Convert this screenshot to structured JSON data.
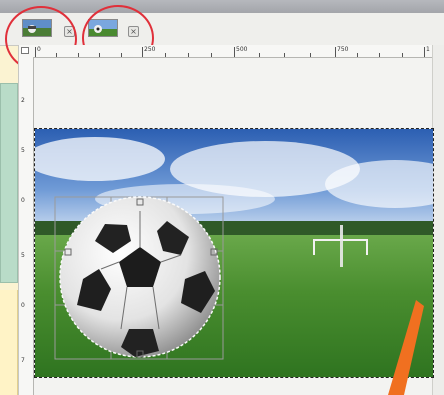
{
  "tabs": [
    {
      "name": "image-tab-1",
      "thumbnail": "shot-thumbnail",
      "close_symbol": "×",
      "highlighted": true
    },
    {
      "name": "image-tab-2",
      "thumbnail": "field-thumbnail",
      "close_symbol": "×",
      "highlighted": true
    }
  ],
  "ruler": {
    "horizontal_labels": [
      "0",
      "250",
      "500",
      "750",
      "1"
    ],
    "vertical_labels": [
      "2",
      "5",
      "0",
      "5",
      "0",
      "7"
    ]
  },
  "canvas": {
    "content": "soccer ball composited onto grass field under cloudy sky",
    "selection": "elliptical selection around ball with transform handles"
  },
  "colors": {
    "highlight_circle": "#e0303a",
    "annotation_arrow": "#f07020",
    "grass": "#3d8a2a",
    "sky": "#2d63b6"
  }
}
